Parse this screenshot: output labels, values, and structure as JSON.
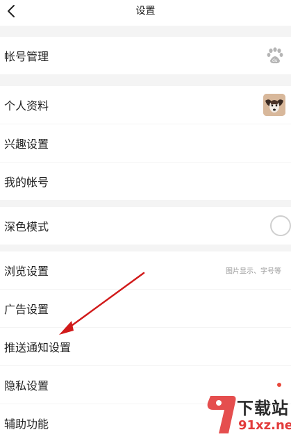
{
  "nav": {
    "title": "设置"
  },
  "account": {
    "label": "帐号管理",
    "logo_icon": "baidu-paw-icon"
  },
  "profile_group": {
    "items": [
      {
        "label": "个人资料",
        "right": "avatar"
      },
      {
        "label": "兴趣设置"
      },
      {
        "label": "我的帐号"
      }
    ]
  },
  "dark_mode": {
    "label": "深色模式",
    "enabled": false
  },
  "settings_group": {
    "items": [
      {
        "label": "浏览设置",
        "hint": "图片显示、字号等"
      },
      {
        "label": "广告设置"
      },
      {
        "label": "推送通知设置"
      },
      {
        "label": "隐私设置",
        "badge": "red-dot"
      },
      {
        "label": "辅助功能"
      }
    ]
  },
  "annotation": {
    "type": "red-arrow",
    "points_to": "推送通知设置"
  },
  "watermark": {
    "brand_mark": "9",
    "text_top": "下载站",
    "text_bottom": "91xz.net"
  },
  "colors": {
    "background": "#f4f4f4",
    "surface": "#ffffff",
    "accent_red": "#e23b3b",
    "text_primary": "#222222",
    "text_hint": "#999999"
  }
}
